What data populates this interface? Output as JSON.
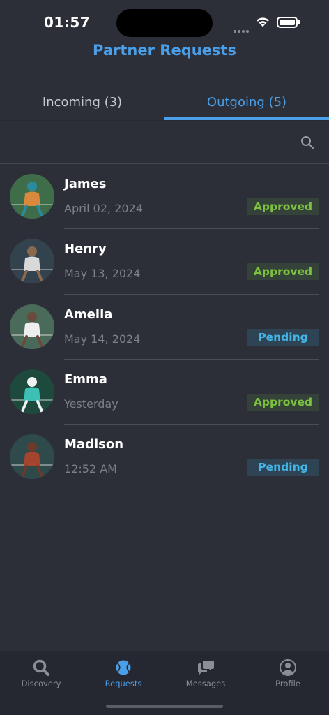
{
  "status_bar": {
    "time": "01:57"
  },
  "header": {
    "title": "Partner Requests"
  },
  "tabs": [
    {
      "label": "Incoming (3)",
      "active": false
    },
    {
      "label": "Outgoing (5)",
      "active": true
    }
  ],
  "search": {
    "icon": "search-icon"
  },
  "requests": [
    {
      "name": "James",
      "date": "April 02, 2024",
      "status": "Approved",
      "avatar_colors": [
        "#3f6d4a",
        "#d8893e",
        "#2a8a9e"
      ]
    },
    {
      "name": "Henry",
      "date": "May 13, 2024",
      "status": "Approved",
      "avatar_colors": [
        "#33434e",
        "#d9d9d9",
        "#8a6a4f"
      ]
    },
    {
      "name": "Amelia",
      "date": "May 14, 2024",
      "status": "Pending",
      "avatar_colors": [
        "#4a6a5a",
        "#eeeeee",
        "#6b4a3a"
      ]
    },
    {
      "name": "Emma",
      "date": "Yesterday",
      "status": "Approved",
      "avatar_colors": [
        "#1e4a3e",
        "#3cc0b5",
        "#f0f0f0"
      ]
    },
    {
      "name": "Madison",
      "date": "12:52 AM",
      "status": "Pending",
      "avatar_colors": [
        "#2e4a4a",
        "#a5442f",
        "#6b3a2a"
      ]
    }
  ],
  "tab_bar": [
    {
      "label": "Discovery",
      "icon": "search-icon",
      "active": false
    },
    {
      "label": "Requests",
      "icon": "tennis-ball-icon",
      "active": true
    },
    {
      "label": "Messages",
      "icon": "chat-bubbles-icon",
      "active": false
    },
    {
      "label": "Profile",
      "icon": "user-circle-icon",
      "active": false
    }
  ],
  "colors": {
    "accent": "#4a9fe8",
    "approved": "#7cc23f",
    "pending": "#43b4e6",
    "background": "#2c2f38"
  }
}
